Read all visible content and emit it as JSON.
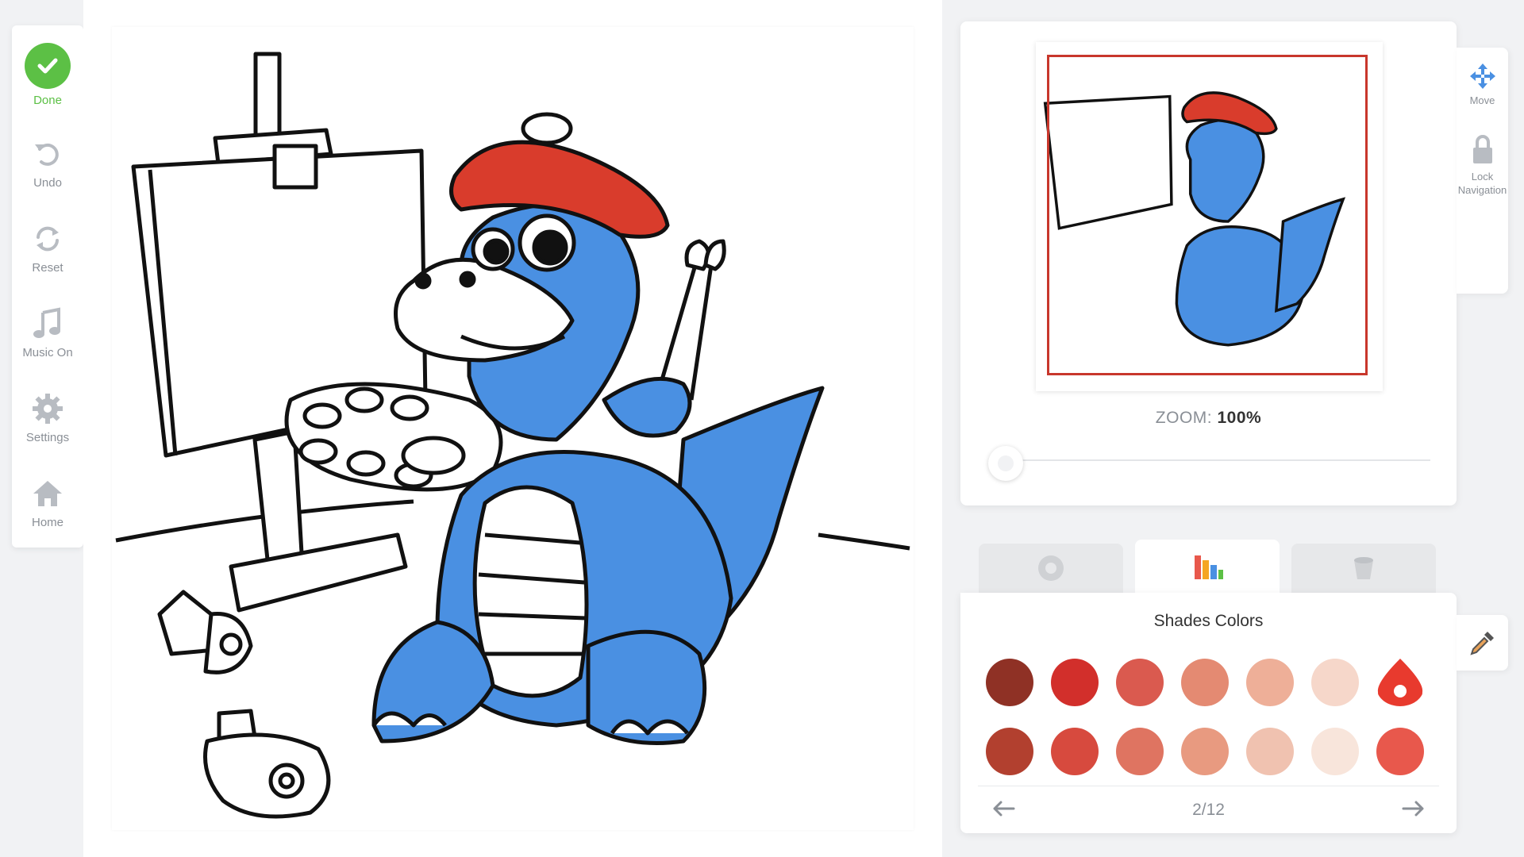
{
  "toolbar": {
    "done": "Done",
    "undo": "Undo",
    "reset": "Reset",
    "music": "Music On",
    "settings": "Settings",
    "home": "Home"
  },
  "preview": {
    "zoom_label": "ZOOM:",
    "zoom_value": "100%"
  },
  "side_tools": {
    "move": "Move",
    "lock_line1": "Lock",
    "lock_line2": "Navigation"
  },
  "palette": {
    "title": "Shades Colors",
    "page": "2/12",
    "row1": [
      "#8f3125",
      "#d22f2b",
      "#da5a4f",
      "#e48a72",
      "#eeaf98",
      "#f6d7ca",
      "#e83a2e"
    ],
    "row2": [
      "#b2402f",
      "#d74a3e",
      "#df7461",
      "#e89a80",
      "#f0c2b0",
      "#f8e5db",
      "#e8584c"
    ]
  },
  "colors": {
    "accent_green": "#5cc045",
    "selected_red": "#c8372c",
    "dino_blue": "#4a90e2",
    "beret_red": "#d93c2c"
  },
  "icons": [
    "check-icon",
    "undo-icon",
    "reset-icon",
    "music-icon",
    "gear-icon",
    "home-icon",
    "move-icon",
    "lock-icon",
    "eyedropper-icon",
    "arrow-left-icon",
    "arrow-right-icon",
    "color-wheel-icon",
    "shades-icon",
    "bucket-icon"
  ]
}
